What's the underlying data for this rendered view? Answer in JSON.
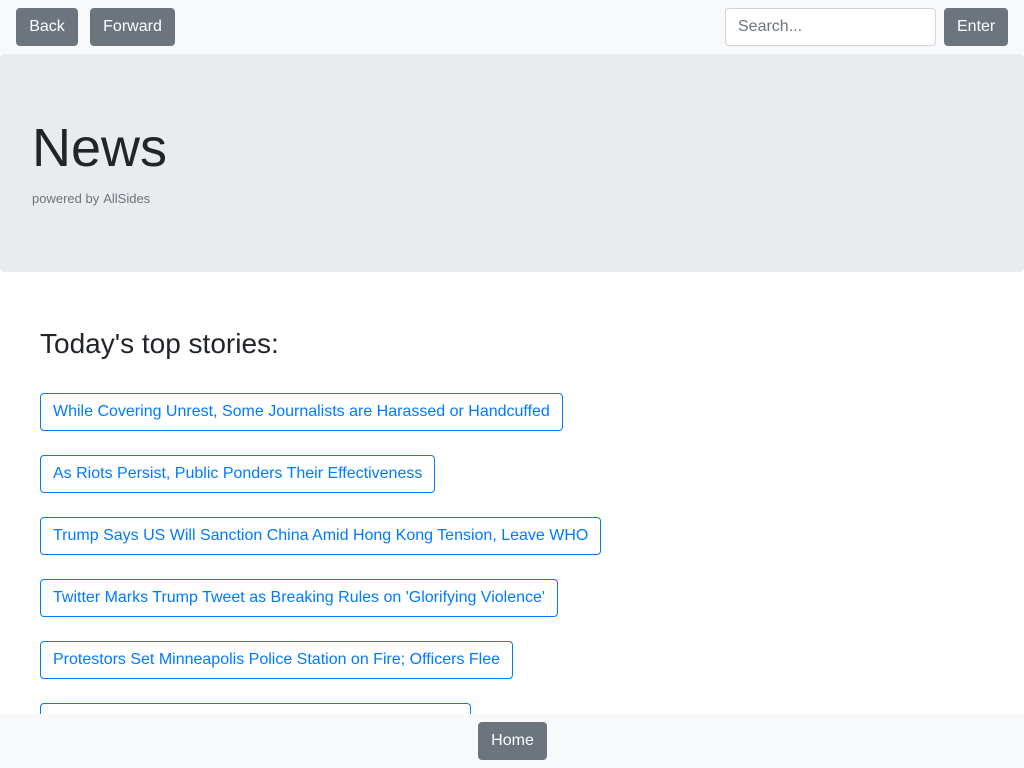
{
  "nav": {
    "back_label": "Back",
    "forward_label": "Forward",
    "search_placeholder": "Search...",
    "enter_label": "Enter"
  },
  "header": {
    "title": "News",
    "powered_by": "powered by",
    "source": "AllSides"
  },
  "main": {
    "section_title": "Today's top stories:",
    "stories": [
      "While Covering Unrest, Some Journalists are Harassed or Handcuffed",
      "As Riots Persist, Public Ponders Their Effectiveness",
      "Trump Says US Will Sanction China Amid Hong Kong Tension, Leave WHO",
      "Twitter Marks Trump Tweet as Breaking Rules on 'Glorifying Violence'",
      "Protestors Set Minneapolis Police Station on Fire; Officers Flee",
      ""
    ]
  },
  "footer": {
    "home_label": "Home"
  },
  "colors": {
    "primary": "#007bff",
    "secondary": "#6c757d",
    "jumbotron_bg": "#e9ecef",
    "nav_bg": "#f8f9fa"
  }
}
